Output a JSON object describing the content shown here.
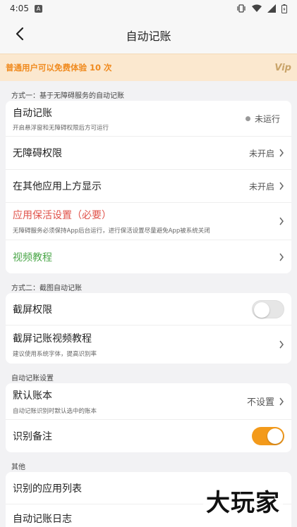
{
  "status": {
    "time": "4:05",
    "notif_badge": "A"
  },
  "appbar": {
    "title": "自动记账"
  },
  "banner": {
    "text": "普通用户可以免费体验 10 次",
    "vip": "Vip"
  },
  "section1": {
    "header": "方式一：基于无障碍服务的自动记账",
    "auto": {
      "title": "自动记账",
      "sub": "开启悬浮窗和无障碍权限后方可运行",
      "status": "未运行"
    },
    "accessibility": {
      "title": "无障碍权限",
      "value": "未开启"
    },
    "overlay": {
      "title": "在其他应用上方显示",
      "value": "未开启"
    },
    "keepalive": {
      "title": "应用保活设置（必要）",
      "sub": "无障碍服务必须保持App后台运行，进行保活设置尽量避免App被系统关闭"
    },
    "video": {
      "title": "视频教程"
    }
  },
  "section2": {
    "header": "方式二：截图自动记账",
    "screenshot": {
      "title": "截屏权限",
      "toggle": 0
    },
    "screenshot_video": {
      "title": "截屏记账视频教程",
      "sub": "建议使用系统字体，提高识别率"
    }
  },
  "section3": {
    "header": "自动记账设置",
    "default_book": {
      "title": "默认账本",
      "sub": "自动记账识别时默认选中的账本",
      "value": "不设置"
    },
    "recognize_note": {
      "title": "识别备注",
      "toggle": 1
    }
  },
  "section4": {
    "header": "其他",
    "apps": {
      "title": "识别的应用列表"
    },
    "log": {
      "title": "自动记账日志"
    }
  },
  "watermark": "大玩家",
  "colors": {
    "accent": "#f39a1b",
    "banner_bg": "#fbe8cf",
    "banner_text": "#f08a1e",
    "red": "#e0524a",
    "green": "#4aa648"
  }
}
